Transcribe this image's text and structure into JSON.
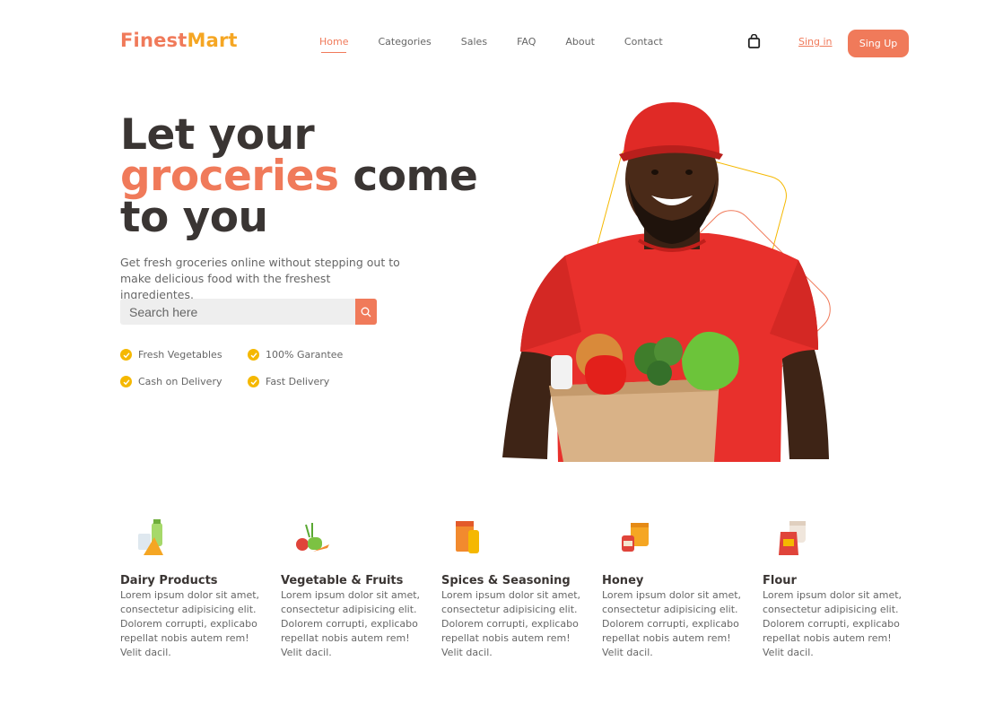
{
  "brand": {
    "part1": "Finest",
    "part2": "Mart"
  },
  "nav": [
    {
      "label": "Home",
      "active": true
    },
    {
      "label": "Categories"
    },
    {
      "label": "Sales"
    },
    {
      "label": "FAQ"
    },
    {
      "label": "About"
    },
    {
      "label": "Contact"
    }
  ],
  "header": {
    "cart_icon": "shopping-bag-icon",
    "signin_label": "Sing in",
    "signup_label": "Sing Up"
  },
  "hero": {
    "title_line1": "Let your",
    "title_accent": "groceries",
    "title_rest": " come",
    "title_line3": "to you",
    "subtitle": "Get fresh groceries online without stepping out to make delicious food with the freshest ingredientes.",
    "search_placeholder": "Search here",
    "search_icon": "search-icon",
    "features": [
      "Fresh Vegetables",
      "100% Garantee",
      "Cash on Delivery",
      "Fast Delivery"
    ]
  },
  "categories": [
    {
      "title": "Dairy Products",
      "icon": "dairy-icon",
      "text": "Lorem ipsum dolor sit amet, consectetur adipisicing elit. Dolorem corrupti, explicabo repellat nobis autem rem! Velit dacil."
    },
    {
      "title": "Vegetable & Fruits",
      "icon": "vegetables-icon",
      "text": "Lorem ipsum dolor sit amet, consectetur adipisicing elit. Dolorem corrupti, explicabo repellat nobis autem rem! Velit dacil."
    },
    {
      "title": "Spices & Seasoning",
      "icon": "spices-icon",
      "text": "Lorem ipsum dolor sit amet, consectetur adipisicing elit. Dolorem corrupti, explicabo repellat nobis autem rem! Velit dacil."
    },
    {
      "title": "Honey",
      "icon": "honey-icon",
      "text": "Lorem ipsum dolor sit amet, consectetur adipisicing elit. Dolorem corrupti, explicabo repellat nobis autem rem! Velit dacil."
    },
    {
      "title": "Flour",
      "icon": "flour-icon",
      "text": "Lorem ipsum dolor sit amet, consectetur adipisicing elit. Dolorem corrupti, explicabo repellat nobis autem rem! Velit dacil."
    }
  ],
  "colors": {
    "accent": "#f07a5a",
    "brand_yellow": "#f5a623",
    "check": "#f5b800",
    "shirt_red": "#e8302c"
  }
}
